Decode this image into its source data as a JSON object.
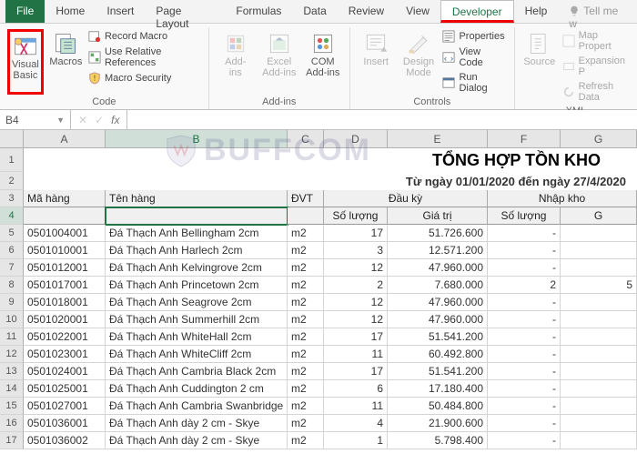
{
  "tabs": {
    "file": "File",
    "home": "Home",
    "insert": "Insert",
    "page_layout": "Page Layout",
    "formulas": "Formulas",
    "data": "Data",
    "review": "Review",
    "view": "View",
    "developer": "Developer",
    "help": "Help",
    "tellme": "Tell me w"
  },
  "ribbon": {
    "code": {
      "visual_basic": "Visual\nBasic",
      "macros": "Macros",
      "record_macro": "Record Macro",
      "use_relative": "Use Relative References",
      "macro_security": "Macro Security",
      "title": "Code"
    },
    "addins": {
      "addins_btn": "Add-\nins",
      "excel_addins": "Excel\nAdd-ins",
      "com_addins": "COM\nAdd-ins",
      "title": "Add-ins"
    },
    "controls": {
      "insert": "Insert",
      "design_mode": "Design\nMode",
      "properties": "Properties",
      "view_code": "View Code",
      "run_dialog": "Run Dialog",
      "title": "Controls"
    },
    "xml": {
      "source": "Source",
      "map_props": "Map Propert",
      "expansion": "Expansion P",
      "refresh": "Refresh Data",
      "title": "XML"
    }
  },
  "namebox": "B4",
  "fx_label": "fx",
  "columns": [
    "A",
    "B",
    "C",
    "D",
    "E",
    "F",
    "G"
  ],
  "sheet": {
    "title": "TỔNG HỢP TỒN KHO",
    "subtitle": "Từ ngày 01/01/2020 đến ngày 27/4/2020",
    "headers_row3": {
      "A": "Mã hàng",
      "B": "Tên hàng",
      "C": "ĐVT",
      "DE": "Đầu kỳ",
      "FG": "Nhập kho"
    },
    "headers_row4": {
      "D": "Số lượng",
      "E": "Giá trị",
      "F": "Số lượng",
      "G": "G"
    },
    "rows": [
      {
        "n": 5,
        "A": "0501004001",
        "B": "Đá Thạch Anh Bellingham 2cm",
        "C": "m2",
        "D": "17",
        "E": "51.726.600",
        "F": "-",
        "G": ""
      },
      {
        "n": 6,
        "A": "0501010001",
        "B": "Đá Thạch Anh Harlech 2cm",
        "C": "m2",
        "D": "3",
        "E": "12.571.200",
        "F": "-",
        "G": ""
      },
      {
        "n": 7,
        "A": "0501012001",
        "B": "Đá Thạch Anh Kelvingrove 2cm",
        "C": "m2",
        "D": "12",
        "E": "47.960.000",
        "F": "-",
        "G": ""
      },
      {
        "n": 8,
        "A": "0501017001",
        "B": "Đá Thạch Anh Princetown 2cm",
        "C": "m2",
        "D": "2",
        "E": "7.680.000",
        "F": "2",
        "G": "5"
      },
      {
        "n": 9,
        "A": "0501018001",
        "B": "Đá Thạch Anh Seagrove 2cm",
        "C": "m2",
        "D": "12",
        "E": "47.960.000",
        "F": "-",
        "G": ""
      },
      {
        "n": 10,
        "A": "0501020001",
        "B": "Đá Thạch Anh Summerhill 2cm",
        "C": "m2",
        "D": "12",
        "E": "47.960.000",
        "F": "-",
        "G": ""
      },
      {
        "n": 11,
        "A": "0501022001",
        "B": "Đá Thạch Anh WhiteHall 2cm",
        "C": "m2",
        "D": "17",
        "E": "51.541.200",
        "F": "-",
        "G": ""
      },
      {
        "n": 12,
        "A": "0501023001",
        "B": "Đá Thạch Anh WhiteCliff 2cm",
        "C": "m2",
        "D": "11",
        "E": "60.492.800",
        "F": "-",
        "G": ""
      },
      {
        "n": 13,
        "A": "0501024001",
        "B": "Đá Thạch Anh Cambria Black 2cm",
        "C": "m2",
        "D": "17",
        "E": "51.541.200",
        "F": "-",
        "G": ""
      },
      {
        "n": 14,
        "A": "0501025001",
        "B": "Đá Thạch Anh Cuddington 2 cm",
        "C": "m2",
        "D": "6",
        "E": "17.180.400",
        "F": "-",
        "G": ""
      },
      {
        "n": 15,
        "A": "0501027001",
        "B": "Đá Thạch Anh Cambria Swanbridge 2cm",
        "C": "m2",
        "D": "11",
        "E": "50.484.800",
        "F": "-",
        "G": ""
      },
      {
        "n": 16,
        "A": "0501036001",
        "B": "Đá Thạch Anh dày 2 cm - Skye",
        "C": "m2",
        "D": "4",
        "E": "21.900.600",
        "F": "-",
        "G": ""
      },
      {
        "n": 17,
        "A": "0501036002",
        "B": "Đá Thạch Anh dày 2 cm - Skye",
        "C": "m2",
        "D": "1",
        "E": "5.798.400",
        "F": "-",
        "G": ""
      }
    ]
  },
  "watermark": "BUFFCOM"
}
